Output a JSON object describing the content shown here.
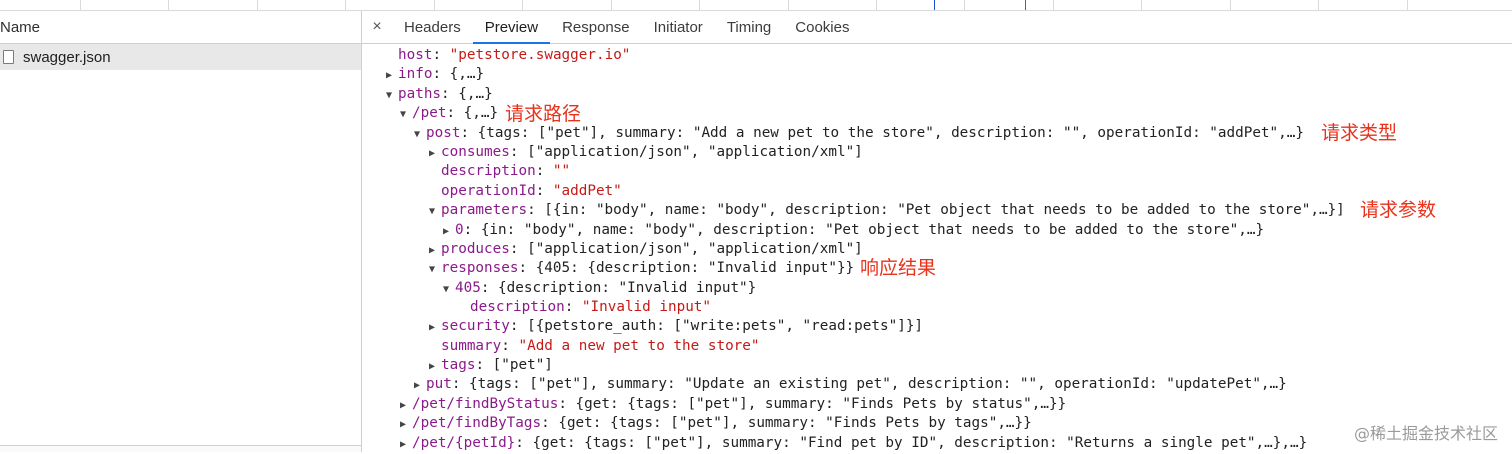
{
  "colors": {
    "key": "#8b1a8b",
    "string": "#c41a16",
    "annotation": "#e8321c",
    "tab_active": "#1a73e8"
  },
  "left_panel": {
    "header": "Name",
    "file": {
      "icon": "file-icon",
      "name": "swagger.json"
    }
  },
  "tabs": {
    "close": "×",
    "items": [
      "Headers",
      "Preview",
      "Response",
      "Initiator",
      "Timing",
      "Cookies"
    ],
    "active": "Preview"
  },
  "tree": {
    "host_key": "host",
    "host_val": "\"petstore.swagger.io\"",
    "info_key": "info",
    "info_val": "{,…}",
    "paths_key": "paths",
    "paths_val": "{,…}",
    "pet_key": "/pet",
    "pet_val": "{,…}",
    "post_key": "post",
    "post_val": "{tags: [\"pet\"], summary: \"Add a new pet to the store\", description: \"\", operationId: \"addPet\",…}",
    "consumes_key": "consumes",
    "consumes_val": "[\"application/json\", \"application/xml\"]",
    "description_key": "description",
    "description_val": "\"\"",
    "operationId_key": "operationId",
    "operationId_val": "\"addPet\"",
    "parameters_key": "parameters",
    "parameters_val": "[{in: \"body\", name: \"body\", description: \"Pet object that needs to be added to the store\",…}]",
    "param0_key": "0",
    "param0_val": "{in: \"body\", name: \"body\", description: \"Pet object that needs to be added to the store\",…}",
    "produces_key": "produces",
    "produces_val": "[\"application/json\", \"application/xml\"]",
    "responses_key": "responses",
    "responses_val": "{405: {description: \"Invalid input\"}}",
    "r405_key": "405",
    "r405_val": "{description: \"Invalid input\"}",
    "r405_desc_key": "description",
    "r405_desc_val": "\"Invalid input\"",
    "security_key": "security",
    "security_val": "[{petstore_auth: [\"write:pets\", \"read:pets\"]}]",
    "summary_key": "summary",
    "summary_val": "\"Add a new pet to the store\"",
    "tags_key": "tags",
    "tags_val": "[\"pet\"]",
    "put_key": "put",
    "put_val": "{tags: [\"pet\"], summary: \"Update an existing pet\", description: \"\", operationId: \"updatePet\",…}",
    "fbs_key": "/pet/findByStatus",
    "fbs_val": "{get: {tags: [\"pet\"], summary: \"Finds Pets by status\",…}}",
    "fbt_key": "/pet/findByTags",
    "fbt_val": "{get: {tags: [\"pet\"], summary: \"Finds Pets by tags\",…}}",
    "petid_key": "/pet/{petId}",
    "petid_val": "{get: {tags: [\"pet\"], summary: \"Find pet by ID\", description: \"Returns a single pet\",…},…}"
  },
  "annotations": {
    "path": "请求路径",
    "method": "请求类型",
    "params": "请求参数",
    "result": "响应结果"
  },
  "watermark": "@稀土掘金技术社区"
}
